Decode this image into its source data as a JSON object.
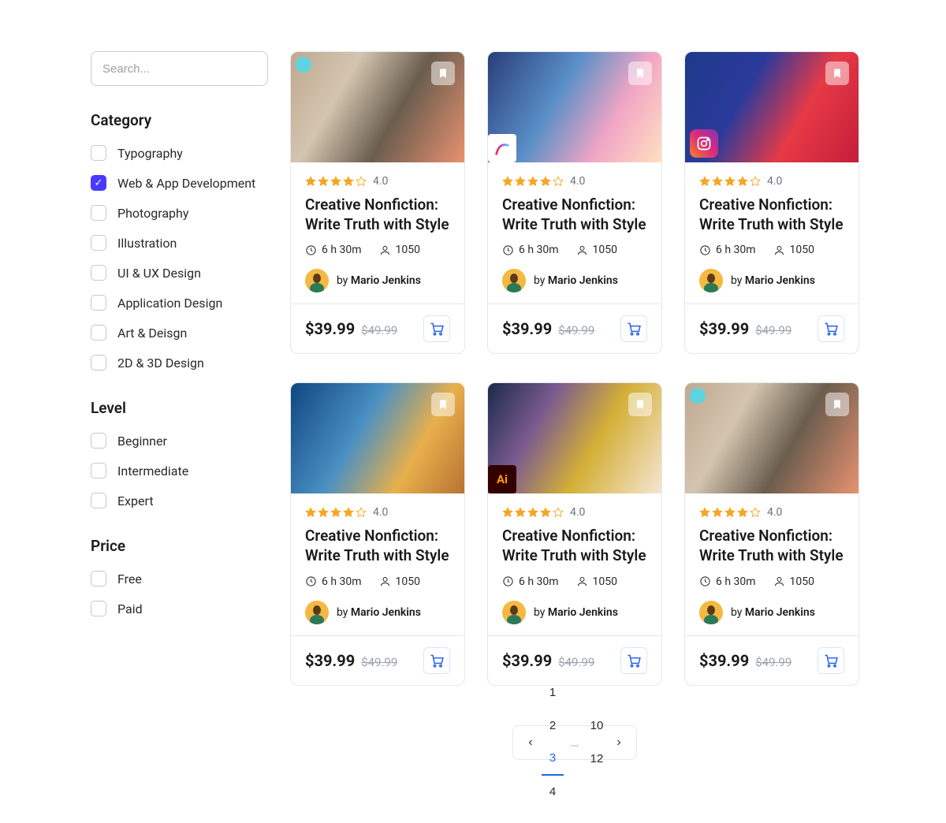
{
  "search": {
    "placeholder": "Search..."
  },
  "filters": {
    "category": {
      "title": "Category",
      "items": [
        {
          "label": "Typography",
          "checked": false
        },
        {
          "label": "Web & App Development",
          "checked": true
        },
        {
          "label": "Photography",
          "checked": false
        },
        {
          "label": "Illustration",
          "checked": false
        },
        {
          "label": "UI & UX Design",
          "checked": false
        },
        {
          "label": "Application Design",
          "checked": false
        },
        {
          "label": "Art & Deisgn",
          "checked": false
        },
        {
          "label": "2D & 3D Design",
          "checked": false
        }
      ]
    },
    "level": {
      "title": "Level",
      "items": [
        {
          "label": "Beginner",
          "checked": false
        },
        {
          "label": "Intermediate",
          "checked": false
        },
        {
          "label": "Expert",
          "checked": false
        }
      ]
    },
    "price": {
      "title": "Price",
      "items": [
        {
          "label": "Free",
          "checked": false
        },
        {
          "label": "Paid",
          "checked": false
        }
      ]
    }
  },
  "courses": [
    {
      "rating": "4.0",
      "title": "Creative Nonfiction: Write Truth with Style",
      "duration": "6 h 30m",
      "students": "1050",
      "byLabel": "by",
      "author": "Mario Jenkins",
      "price": "$39.99",
      "oldPrice": "$49.99",
      "imgClass": "fx0",
      "hasCyanDot": true
    },
    {
      "rating": "4.0",
      "title": "Creative Nonfiction: Write Truth with Style",
      "duration": "6 h 30m",
      "students": "1050",
      "byLabel": "by",
      "author": "Mario Jenkins",
      "price": "$39.99",
      "oldPrice": "$49.99",
      "imgClass": "fx1",
      "hasProcreate": true
    },
    {
      "rating": "4.0",
      "title": "Creative Nonfiction: Write Truth with Style",
      "duration": "6 h 30m",
      "students": "1050",
      "byLabel": "by",
      "author": "Mario Jenkins",
      "price": "$39.99",
      "oldPrice": "$49.99",
      "imgClass": "fx2",
      "hasInstagram": true
    },
    {
      "rating": "4.0",
      "title": "Creative Nonfiction: Write Truth with Style",
      "duration": "6 h 30m",
      "students": "1050",
      "byLabel": "by",
      "author": "Mario Jenkins",
      "price": "$39.99",
      "oldPrice": "$49.99",
      "imgClass": "fx3"
    },
    {
      "rating": "4.0",
      "title": "Creative Nonfiction: Write Truth with Style",
      "duration": "6 h 30m",
      "students": "1050",
      "byLabel": "by",
      "author": "Mario Jenkins",
      "price": "$39.99",
      "oldPrice": "$49.99",
      "imgClass": "fx4",
      "hasAi": true
    },
    {
      "rating": "4.0",
      "title": "Creative Nonfiction: Write Truth with Style",
      "duration": "6 h 30m",
      "students": "1050",
      "byLabel": "by",
      "author": "Mario Jenkins",
      "price": "$39.99",
      "oldPrice": "$49.99",
      "imgClass": "fx5",
      "hasCyanDot": true
    }
  ],
  "pagination": {
    "pages": [
      "1",
      "2",
      "3",
      "4"
    ],
    "active": "3",
    "ellipsis": "…",
    "tail": [
      "10",
      "12"
    ]
  }
}
